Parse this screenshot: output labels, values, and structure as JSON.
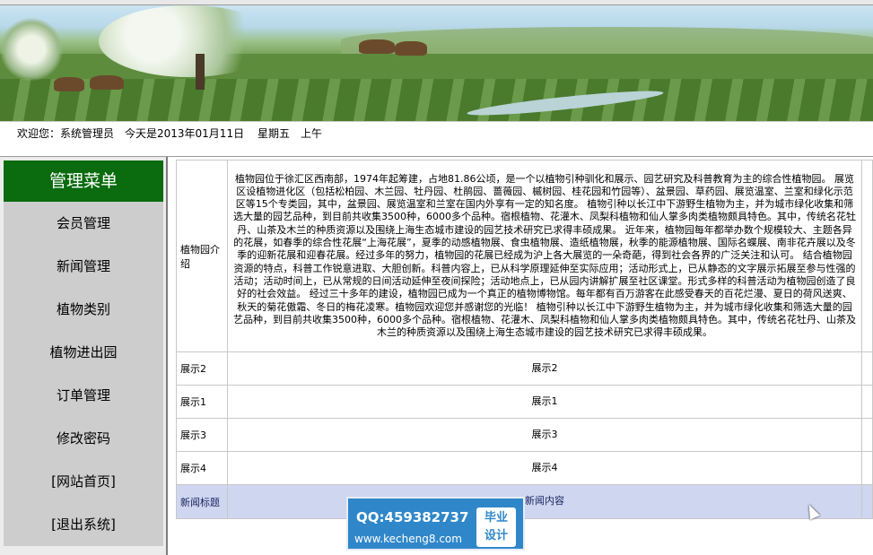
{
  "welcome": {
    "user_text": "欢迎您：系统管理员",
    "date_text": "今天是2013年01月11日",
    "weekday": "星期五",
    "period": "上午"
  },
  "sidebar": {
    "title": "管理菜单",
    "items": [
      {
        "label": "会员管理"
      },
      {
        "label": "新闻管理"
      },
      {
        "label": "植物类别"
      },
      {
        "label": "植物进出园"
      },
      {
        "label": "订单管理"
      },
      {
        "label": "修改密码"
      },
      {
        "label": "[网站首页]"
      },
      {
        "label": "[退出系统]"
      }
    ]
  },
  "news": {
    "rows": [
      {
        "title": "植物园介绍",
        "content": "植物园位于徐汇区西南部，1974年起筹建，占地81.86公顷，是一个以植物引种驯化和展示、园艺研究及科普教育为主的综合性植物园。 展览区设植物进化区（包括松柏园、木兰园、牡丹园、杜鹃园、蔷薇园、槭树园、桂花园和竹园等）、盆景园、草药园、展览温室、兰室和绿化示范区等15个专类园，其中，盆景园、展览温室和兰室在国内外享有一定的知名度。 植物引种以长江中下游野生植物为主，并为城市绿化收集和筛选大量的园艺品种，到目前共收集3500种，6000多个品种。宿根植物、花灌木、凤梨科植物和仙人掌多肉类植物颇具特色。其中，传统名花牡丹、山茶及木兰的种质资源以及围绕上海生态城市建设的园艺技术研究已求得丰硕成果。 近年来，植物园每年都举办数个规模较大、主题各异的花展，如春季的综合性花展“上海花展”，夏季的动感植物展、食虫植物展、造纸植物展，秋季的能源植物展、国际名蝶展、南非花卉展以及冬季的迎新花展和迎春花展。经过多年的努力，植物园的花展已经成为沪上各大展览的一朵奇葩，得到社会各界的广泛关注和认可。 结合植物园资源的特点，科普工作锐意进取、大胆创新。科普内容上，已从科学原理延伸至实际应用；活动形式上，已从静态的文字展示拓展至参与性强的活动；活动时间上，已从常规的日间活动延伸至夜间探险；活动地点上，已从园内讲解扩展至社区课堂。形式多样的科普活动为植物园创造了良好的社会效益。 经过三十多年的建设，植物园已成为一个真正的植物博物馆。每年都有百万游客在此感受春天的百花烂漫、夏日的荷风送爽、秋天的菊花傲霜、冬日的梅花凌寒。植物园欢迎您并感谢您的光临！ 植物引种以长江中下游野生植物为主，并为城市绿化收集和筛选大量的园艺品种，到目前共收集3500种，6000多个品种。宿根植物、花灌木、凤梨科植物和仙人掌多肉类植物颇具特色。其中，传统名花牡丹、山茶及木兰的种质资源以及围绕上海生态城市建设的园艺技术研究已求得丰硕成果。"
      },
      {
        "title": "展示2",
        "content": "展示2"
      },
      {
        "title": "展示1",
        "content": "展示1"
      },
      {
        "title": "展示3",
        "content": "展示3"
      },
      {
        "title": "展示4",
        "content": "展示4"
      }
    ],
    "footer": {
      "title_header": "新闻标题",
      "content_header": "新闻内容"
    }
  },
  "watermark": {
    "qq": "QQ:459382737",
    "site": "www.kecheng8.com",
    "badge_line1": "毕业",
    "badge_line2": "设计"
  }
}
